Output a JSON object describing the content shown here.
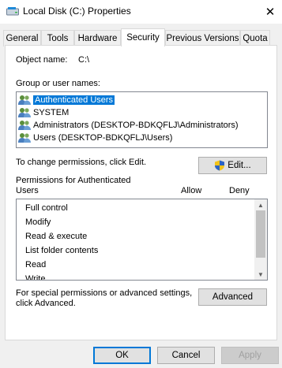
{
  "window": {
    "title": "Local Disk (C:) Properties"
  },
  "tabs": [
    {
      "label": "General"
    },
    {
      "label": "Tools"
    },
    {
      "label": "Hardware"
    },
    {
      "label": "Security"
    },
    {
      "label": "Previous Versions"
    },
    {
      "label": "Quota"
    }
  ],
  "security": {
    "object_name_label": "Object name:",
    "object_name_value": "C:\\",
    "group_label": "Group or user names:",
    "users": [
      {
        "label": "Authenticated Users",
        "selected": true
      },
      {
        "label": "SYSTEM"
      },
      {
        "label": "Administrators (DESKTOP-BDKQFLJ\\Administrators)"
      },
      {
        "label": "Users (DESKTOP-BDKQFLJ\\Users)"
      }
    ],
    "change_hint": "To change permissions, click Edit.",
    "edit_button": "Edit...",
    "permissions_title_line1": "Permissions for Authenticated",
    "permissions_title_line2": "Users",
    "allow_header": "Allow",
    "deny_header": "Deny",
    "permissions": [
      {
        "label": "Full control"
      },
      {
        "label": "Modify"
      },
      {
        "label": "Read & execute"
      },
      {
        "label": "List folder contents"
      },
      {
        "label": "Read"
      },
      {
        "label": "Write"
      }
    ],
    "advanced_hint_line1": "For special permissions or advanced settings,",
    "advanced_hint_line2": "click Advanced.",
    "advanced_button": "Advanced"
  },
  "footer": {
    "ok": "OK",
    "cancel": "Cancel",
    "apply": "Apply"
  },
  "icons": {
    "close": "✕"
  },
  "colors": {
    "selection": "#0078d7",
    "shield_blue": "#2b63c7",
    "shield_yellow": "#f2c31a"
  }
}
